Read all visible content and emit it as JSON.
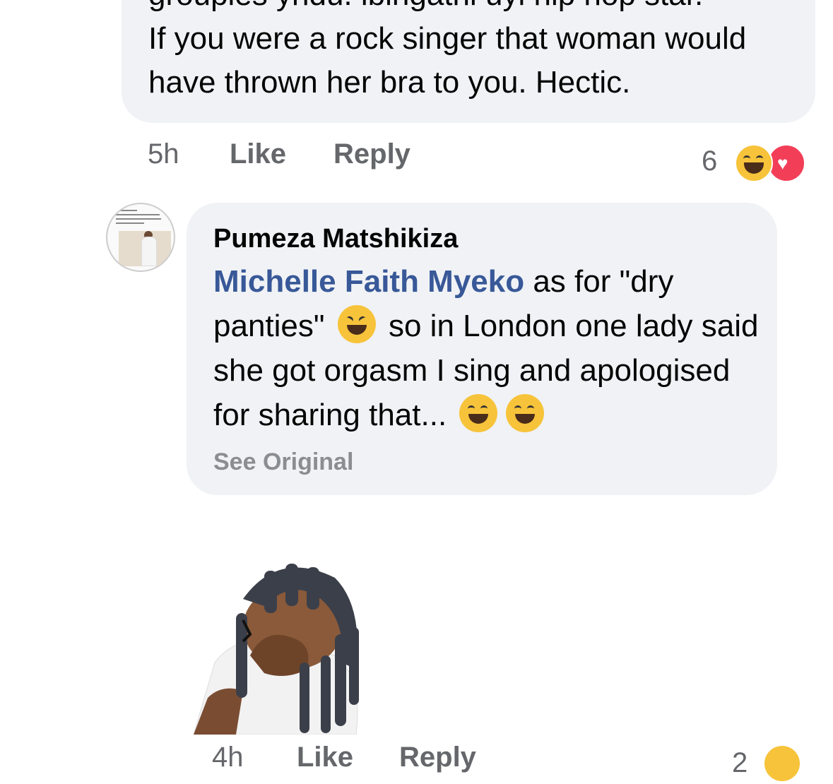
{
  "comment_1": {
    "text_partial_top": "groupies yhdu. ibingathi uyi hip hop star.",
    "text": "If you were a rock singer that woman would have thrown her bra to you. Hectic.",
    "time": "5h",
    "like_label": "Like",
    "reply_label": "Reply",
    "reaction_count": "6",
    "reactions": [
      "haha-icon",
      "love-icon"
    ]
  },
  "comment_2": {
    "author": "Pumeza Matshikiza",
    "mention": "Michelle Faith Myeko",
    "text_part1": " as for \"dry panties\"",
    "text_part2": " so in London one lady said she got orgasm I sing and apologised for sharing that...",
    "see_original": "See Original",
    "emojis": [
      "laughing-squint-emoji",
      "grinning-emoji",
      "grinning-emoji"
    ]
  },
  "comment_3": {
    "sticker": "facepalm-avatar-sticker",
    "time": "4h",
    "like_label": "Like",
    "reply_label": "Reply",
    "reaction_count": "2"
  }
}
